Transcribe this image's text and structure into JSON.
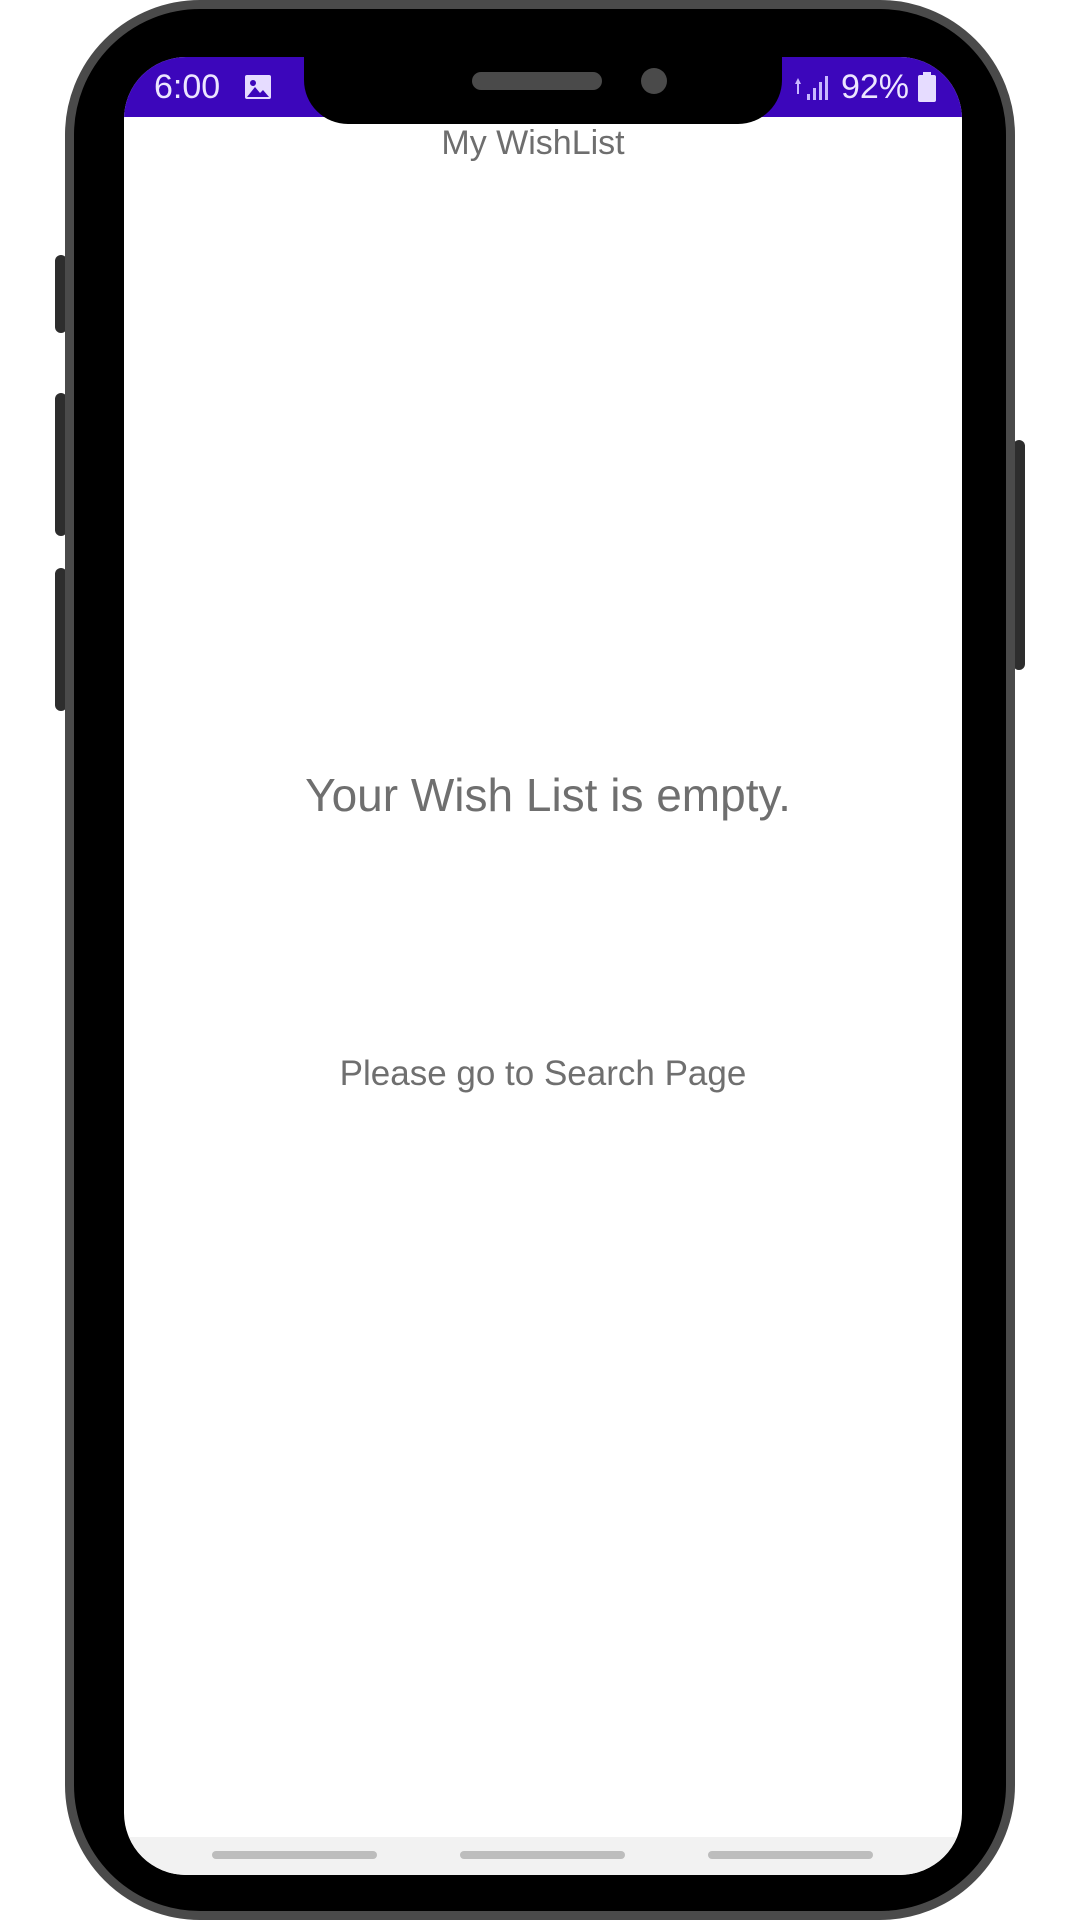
{
  "status_bar": {
    "time": "6:00",
    "battery": "92%",
    "color": "#3c06bb"
  },
  "icons": {
    "gallery": "image-icon",
    "signal": "signal-icon",
    "battery": "battery-icon"
  },
  "app": {
    "title": "My WishList"
  },
  "main": {
    "empty_message": "Your Wish List is empty.",
    "search_link": "Please go to Search Page"
  },
  "colors": {
    "text": "#6f6f6f",
    "frame": "#4a4a4a"
  }
}
